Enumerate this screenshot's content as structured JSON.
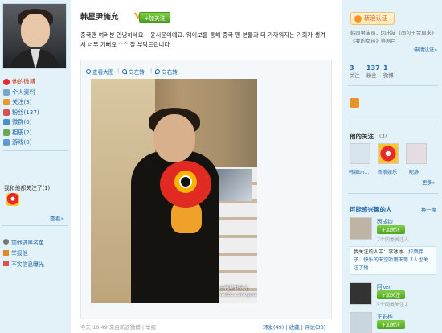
{
  "sidebar": {
    "nav": [
      {
        "label": "他的微博",
        "active": true,
        "icon": "weibo-icon",
        "color": "#e8292b"
      },
      {
        "label": "个人资料",
        "icon": "profile-icon",
        "color": "#7aa4c9"
      },
      {
        "label": "关注(3)",
        "icon": "follow-icon",
        "color": "#e59a2f"
      },
      {
        "label": "粉丝(137)",
        "icon": "fans-icon",
        "color": "#d6534f"
      },
      {
        "label": "微群(0)",
        "icon": "group-icon",
        "color": "#4a8fc6"
      },
      {
        "label": "相册(2)",
        "icon": "album-icon",
        "color": "#6aa84f"
      },
      {
        "label": "游戏(0)",
        "icon": "game-icon",
        "color": "#5b9bd5"
      }
    ],
    "fans_title": "我和他都关注了(1)",
    "more": "查看»",
    "sub": [
      {
        "label": "加他进黑名单",
        "icon": "blacklist-icon"
      },
      {
        "label": "举报他",
        "icon": "report-icon"
      },
      {
        "label": "不实信息曝光",
        "icon": "expose-icon"
      }
    ]
  },
  "main": {
    "username": "韩星尹施允",
    "follow_btn": "+加关注",
    "post_text": "중국팬 여러분 안녕하세요~ 윤시윤이예요. 웨이보를 통해 중국 팬 분들과 더 가까워지는 기회가 생겨서 너무 기뻐요 ^^ 잘 부탁드립니다",
    "photo_tools": [
      "查看大图",
      "向左转",
      "向右转"
    ],
    "watermark_name": "@韩星尹施允",
    "watermark_url": "weibo.com/yoonsiyun",
    "meta": "今天 10:49 来自新浪微博 | 举报",
    "actions": "转发(49) | 收藏 | 评论(33)"
  },
  "right": {
    "verify_btn": "新浪认证",
    "desc": "韩国男演员，因出演《面包王金卓求》《我的女孩》等剧目",
    "edit": "申请认证»",
    "stats": [
      {
        "num": "3",
        "label": "关注"
      },
      {
        "num": "137",
        "label": "粉丝"
      },
      {
        "num": "1",
        "label": "微博"
      }
    ],
    "follows_title": "他的关注",
    "follows_count": "(3)",
    "follows": [
      {
        "name": "韩娱bn...",
        "color": "#d7e4ee"
      },
      {
        "name": "新浪娱乐",
        "color": "#f4e0e0"
      },
      {
        "name": "昵静",
        "color": "#e6dde0"
      }
    ],
    "more": "更多»",
    "interest_title": "可能感兴趣的人",
    "refresh": "换一换",
    "recs": [
      {
        "name": "丙成钧",
        "btn": "+加关注",
        "sub": "7个同类关注人",
        "color": "#bfb3a6"
      },
      {
        "name": "阿ken",
        "btn": "+加关注",
        "sub": "5个同类关注人",
        "color": "#333"
      },
      {
        "name": "王彩桦",
        "btn": "+加关注",
        "color": "#c9d6e0"
      }
    ],
    "rec_note_a": "我关注的人中：李冰冰、",
    "rec_note_b": "拉面胖子、快乐的天空听雨天等 7人也关注了他"
  }
}
